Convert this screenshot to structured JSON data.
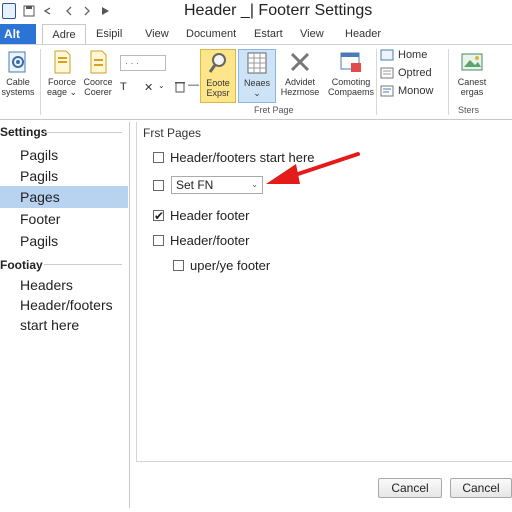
{
  "window": {
    "title": "Header _| Footerr Settings"
  },
  "tabs": [
    "Alt",
    "Adre",
    "Esipil",
    "View",
    "Document",
    "Estart",
    "View",
    "Header"
  ],
  "ribbon": {
    "buttons": [
      {
        "label1": "Cable",
        "label2": "systems",
        "icon": "settings-gear-icon"
      },
      {
        "label1": "Foorce",
        "label2": "eage ⌄",
        "icon": "page-icon"
      },
      {
        "label1": "Coorce",
        "label2": "Coerer",
        "icon": "page-icon"
      },
      {
        "label1": "Eoote",
        "label2": "Expsr",
        "icon": "search-icon"
      },
      {
        "label1": "Neaes",
        "label2": "⌄",
        "icon": "grid-icon"
      },
      {
        "label1": "Advidet",
        "label2": "Hezrnose",
        "icon": "tools-icon"
      },
      {
        "label1": "Comoting",
        "label2": "Compaems",
        "icon": "window-icon"
      },
      {
        "label1": "Canest",
        "label2": "ergas",
        "icon": "image-icon"
      }
    ],
    "mini": {
      "dropdown": "·  ·  ·",
      "x": "✕",
      "minus": "—"
    },
    "side_items": [
      "Home",
      "Optred",
      "Monow"
    ],
    "group_labels": {
      "first_page": "Fret Page",
      "sters": "Sters"
    }
  },
  "nav": {
    "section1": "Settings",
    "items1": [
      "Pagils",
      "Pagils",
      "Pages",
      "Footer",
      "Pagils"
    ],
    "section2": "Footiay",
    "items2": [
      "Headers",
      "Header/footers",
      "start here"
    ],
    "selected_index": 2
  },
  "main": {
    "heading": "Frst Pages",
    "options": [
      {
        "label": "Header/footers start here",
        "checked": false
      },
      {
        "label": "Header footer",
        "checked": true
      },
      {
        "label": "Header/footer",
        "checked": false
      },
      {
        "label": "uper/ye footer",
        "checked": false
      }
    ],
    "select": {
      "value": "Set FN",
      "checked": false
    }
  },
  "buttons": {
    "cancel1": "Cancel",
    "cancel2": "Cancel"
  },
  "colors": {
    "accent": "#2b74d6",
    "selection": "#b7d3f0",
    "arrow": "#e31b1b"
  }
}
